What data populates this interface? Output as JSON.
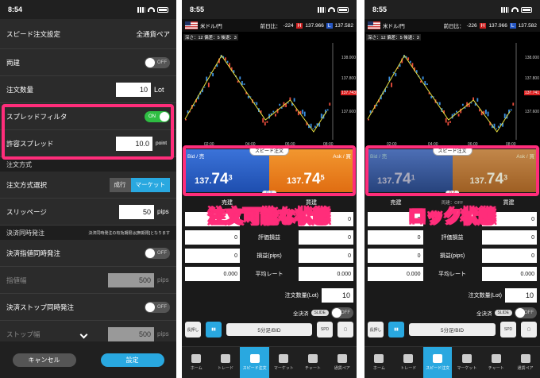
{
  "p1": {
    "time": "8:54",
    "title": "スピード注文設定",
    "all_pairs": "全通貨ペア",
    "ryodate": "両建",
    "off": "OFF",
    "on": "ON",
    "qty_label": "注文数量",
    "qty_value": "10",
    "qty_unit": "Lot",
    "spread_filter": "スプレッドフィルタ",
    "allow_spread": "許容スプレッド",
    "spread_value": "10.0",
    "spread_unit": "point",
    "sec_method": "注文方式",
    "method_select": "注文方式選択",
    "market_order": "成行",
    "market": "マーケット",
    "slippage": "スリッページ",
    "slip_value": "50",
    "slip_unit": "pips",
    "sec_settle": "決済同時発注",
    "settle_note": "決済同時発注の有効期限は[無期限]となります",
    "limit_settle": "決済指値同時発注",
    "limit_width": "指値幅",
    "limit_value": "500",
    "stop_settle": "決済ストップ同時発注",
    "stop_width": "ストップ幅",
    "stop_value": "500",
    "cancel": "キャンセル",
    "ok": "設定"
  },
  "p2": {
    "time": "8:55",
    "pair": "米ドル/円",
    "prev_label": "前日比：",
    "prev": "-224",
    "high": "137.966",
    "low": "137.582",
    "indicator": "深さ：12 偏差：5 後退：3",
    "bid_label": "Bid / 売",
    "ask_label": "Ask / 買",
    "bid_main": "137.",
    "bid_big": "74",
    "bid_small": "3",
    "ask_main": "137.",
    "ask_big": "74",
    "ask_small": "5",
    "spread": "0.2",
    "badge": "スピード注文",
    "price_tag": "137.743",
    "overlay": "注文可能な状態",
    "sell": "売建",
    "buy": "買建",
    "m1": "0",
    "m2": "0",
    "m3": "0",
    "m4": "0.000",
    "eval": "評価損益",
    "pl": "損益(pips)",
    "avg": "平均レート",
    "qty_label": "注文数量(Lot)",
    "qty_value": "10",
    "close_all": "全決済",
    "slide": "SLIDE",
    "off": "OFF",
    "select": "5分足/BID",
    "lock": "長押し"
  },
  "p3": {
    "time": "8:55",
    "pair": "米ドル/円",
    "prev_label": "前日比：",
    "prev": "-226",
    "high": "137.966",
    "low": "137.582",
    "indicator": "深さ：12 偏差：5 後退：3",
    "bid_label": "Bid / 売",
    "ask_label": "Ask / 買",
    "bid_main": "137.",
    "bid_big": "74",
    "bid_small": "1",
    "ask_main": "137.",
    "ask_big": "74",
    "ask_small": "3",
    "spread": "0.2",
    "badge": "スピード注文",
    "price_tag": "137.741",
    "overlay": "ロック状態",
    "sell": "売建",
    "buy": "買建",
    "mid": "両建：OFF",
    "m1": "0",
    "m2": "0",
    "m3": "0",
    "m4": "0.000",
    "eval": "評価損益",
    "pl": "損益(pips)",
    "avg": "平均レート",
    "qty_label": "注文数量(Lot)",
    "qty_value": "10",
    "close_all": "全決済",
    "slide": "SLIDE",
    "off": "OFF",
    "select": "5分足/BID",
    "lock": "長押し"
  },
  "axis": {
    "p1": "138.000",
    "p2": "137.800",
    "p3": "137.600",
    "t1": "02:00",
    "t2": "04:00",
    "t3": "06:00",
    "t4": "08:00"
  },
  "nav": {
    "home": "ホーム",
    "trade": "トレード",
    "speed": "スピード注文",
    "market": "マーケット",
    "chart": "チャート",
    "pairs": "通貨ペア"
  },
  "colors": {
    "highlight": "#ff2d7a",
    "bid": "#1e4eaf",
    "ask": "#e06d12",
    "toggle_on": "#2ebd42",
    "accent": "#29a8e0"
  }
}
